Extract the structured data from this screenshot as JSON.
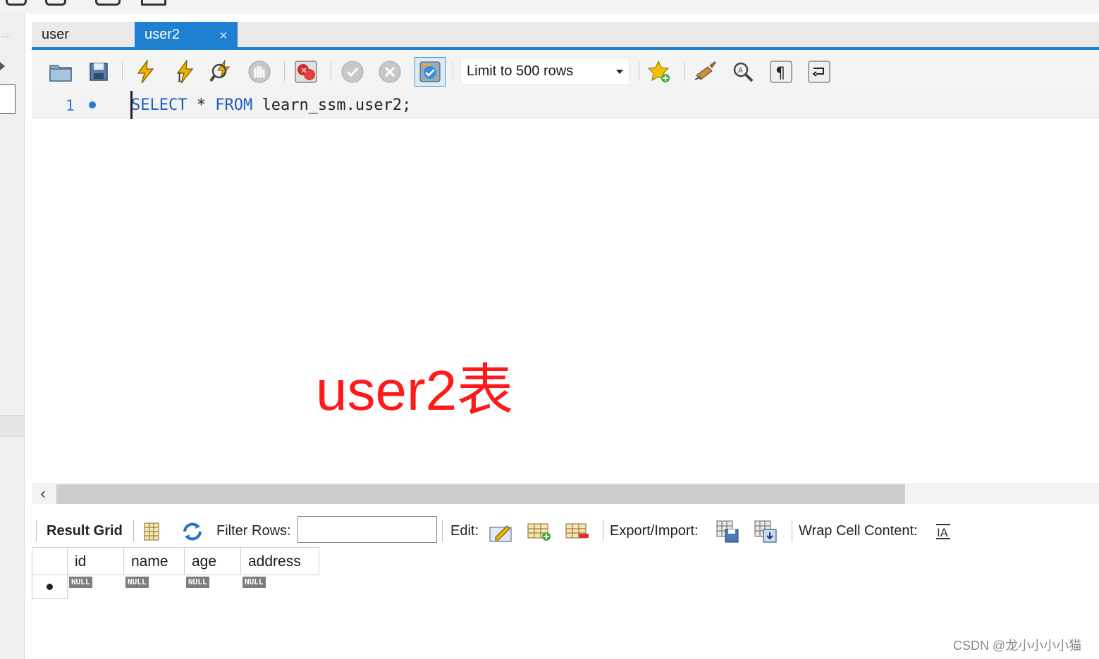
{
  "tabs": [
    {
      "label": "user",
      "active": false
    },
    {
      "label": "user2",
      "active": true
    }
  ],
  "tab_close_glyph": "×",
  "toolbar": {
    "icons": [
      "open-folder-icon",
      "save-icon",
      "execute-icon",
      "execute-current-icon",
      "explain-icon",
      "stop-icon",
      "stop-on-error-icon",
      "commit-icon",
      "rollback-icon",
      "autocommit-icon",
      "bookmark-icon",
      "beautify-icon",
      "find-icon",
      "invisible-chars-icon",
      "wrap-icon"
    ],
    "limit_label": "Limit to 500 rows"
  },
  "editor": {
    "line_number": "1",
    "code": {
      "kw1": "SELECT",
      "star": " * ",
      "kw2": "FROM",
      "rest": " learn_ssm.user2;"
    }
  },
  "overlay_text": "user2表",
  "result_toolbar": {
    "result_grid": "Result Grid",
    "filter_rows": "Filter Rows:",
    "filter_value": "",
    "edit": "Edit:",
    "export_import": "Export/Import:",
    "wrap_cell": "Wrap Cell Content:"
  },
  "grid": {
    "columns": [
      "id",
      "name",
      "age",
      "address"
    ],
    "null_label": "NULL"
  },
  "watermark": "CSDN @龙小小小小猫",
  "colors": {
    "accent": "#1f7fd0",
    "overlay": "#ff1a1a",
    "keyword": "#1f5fb8"
  }
}
